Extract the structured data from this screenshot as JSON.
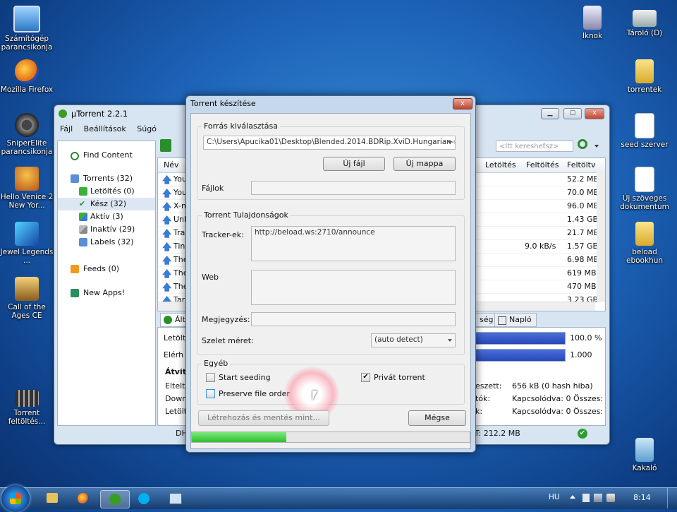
{
  "desktop": {
    "left_icons": [
      {
        "label": "Számítógép parancsikonja",
        "icon": "computer-icon"
      },
      {
        "label": "Mozilla Firefox",
        "icon": "firefox-icon"
      },
      {
        "label": "SniperElite parancsikonja",
        "icon": "sniper-icon"
      },
      {
        "label": "Hello Venice 2 New Yor...",
        "icon": "game-icon"
      },
      {
        "label": "Jewel Legends ...",
        "icon": "jewel-icon"
      },
      {
        "label": "Call of the Ages CE",
        "icon": "game-icon"
      },
      {
        "label": "Torrent feltöltés...",
        "icon": "film-icon"
      }
    ],
    "right_icons": [
      {
        "label": "Iknok",
        "icon": "documents-icon"
      },
      {
        "label": "Tároló (D)",
        "icon": "drive-icon"
      },
      {
        "label": "torrentek",
        "icon": "folder-icon"
      },
      {
        "label": "seed szerver",
        "icon": "document-icon"
      },
      {
        "label": "Új szöveges dokumentum",
        "icon": "document-icon"
      },
      {
        "label": "beload ebookhun",
        "icon": "folder-icon"
      },
      {
        "label": "Kakaló",
        "icon": "recycle-bin-icon"
      }
    ]
  },
  "utorrent": {
    "title": "µTorrent 2.2.1",
    "menu": [
      "Fájl",
      "Beállítások",
      "Súgó"
    ],
    "search_placeholder": "<Itt keresheťsz>",
    "sidebar": {
      "find_content": "Find Content",
      "items": [
        {
          "label": "Torrents (32)"
        },
        {
          "label": "Letöltés (0)"
        },
        {
          "label": "Kész (32)"
        },
        {
          "label": "Aktív (3)"
        },
        {
          "label": "Inaktív (29)"
        },
        {
          "label": "Labels (32)"
        }
      ],
      "feeds": "Feeds (0)",
      "new_apps": "New Apps!"
    },
    "columns": {
      "name": "Név",
      "down": "Letöltés",
      "up": "Feltöltés",
      "uploaded": "Feltöltv"
    },
    "rows": [
      {
        "name": "You",
        "down": "",
        "uploaded": "52.2 MB"
      },
      {
        "name": "You",
        "down": "",
        "uploaded": "70.0 MB"
      },
      {
        "name": "X-n",
        "down": "",
        "uploaded": "96.0 MB"
      },
      {
        "name": "Unk",
        "down": "",
        "uploaded": "1.43 GB"
      },
      {
        "name": "Tra",
        "down": "",
        "uploaded": "21.7 MB"
      },
      {
        "name": "Tin",
        "down": "9.0 kB/s",
        "uploaded": "1.57 GB"
      },
      {
        "name": "The",
        "down": "",
        "uploaded": "6.98 MB"
      },
      {
        "name": "The",
        "down": "",
        "uploaded": "619 MB"
      },
      {
        "name": "The",
        "down": "",
        "uploaded": "470 MB"
      },
      {
        "name": "Tar",
        "down": "",
        "uploaded": "3.23 GB"
      }
    ],
    "bottom_tabs": {
      "general": "Ált",
      "speed": "ség",
      "log": "Napló"
    },
    "info": {
      "downloaded_label": "Letölt",
      "available_label": "Elérh",
      "progress_value": "100.0 %",
      "availability_value": "1.000",
      "progress_fraction": 1.0,
      "transfer_label": "Átvit",
      "elapsed_label": "Eltelt",
      "down_label": "Down",
      "dl_label": "Letölt",
      "wasted_label": "eszett:",
      "wasted_value": "656 kB (0 hash hiba)",
      "seeds_label": "tók:",
      "seeds_value": "Kapcsolódva: 0 Összes:",
      "peers_label": "k:",
      "peers_value": "Kapcsolódva: 0 Összes:"
    },
    "statusbar": {
      "left": "DH",
      "right": "T: 212.2 MB"
    }
  },
  "dialog": {
    "title": "Torrent készítése",
    "close": "x",
    "source_group": "Forrás kiválasztása",
    "source_path": "C:\\Users\\Apucika01\\Desktop\\Blended.2014.BDRip.XviD.Hungarian-r",
    "new_file_button": "Új fájl",
    "new_folder_button": "Új mappa",
    "files_label": "Fájlok",
    "props_group": "Torrent Tulajdonságok",
    "tracker_label": "Tracker-ek:",
    "tracker_value": "http://beload.ws:2710/announce",
    "web_label": "Web",
    "comment_label": "Megjegyzés:",
    "piece_label": "Szelet méret:",
    "piece_value": "(auto detect)",
    "other_group": "Egyéb",
    "start_seeding": "Start seeding",
    "start_seeding_checked": false,
    "private_torrent": "Privát torrent",
    "private_torrent_checked": true,
    "preserve_order": "Preserve file order",
    "preserve_order_checked": false,
    "create_button": "Létrehozás és mentés mint...",
    "cancel_button": "Mégse",
    "progress_fraction": 0.34
  },
  "taskbar": {
    "lang": "HU",
    "time": "8:14"
  },
  "colors": {
    "accent": "#2f7be0",
    "progress_green": "#3fcf3f"
  }
}
